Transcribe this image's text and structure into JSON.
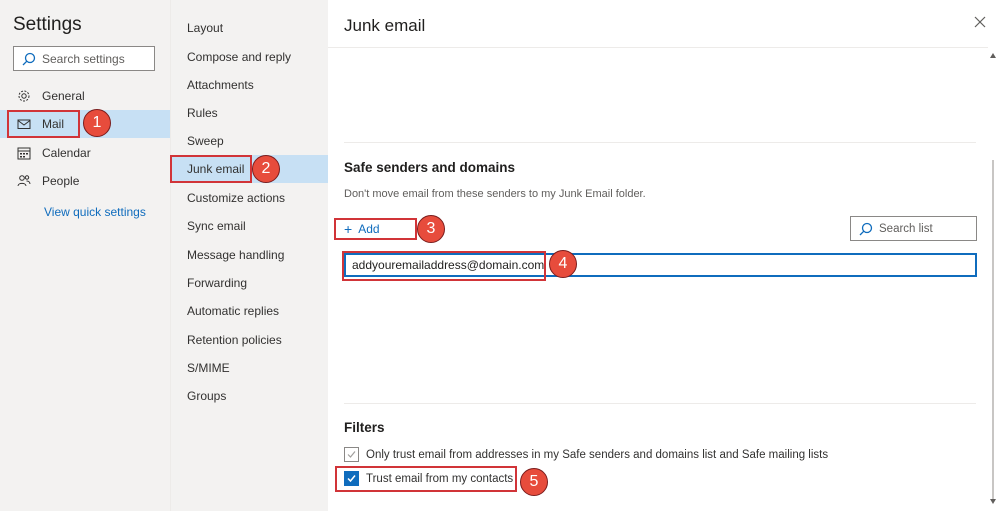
{
  "settings": {
    "title": "Settings",
    "search_placeholder": "Search settings",
    "nav": [
      {
        "label": "General",
        "icon": "gear-icon"
      },
      {
        "label": "Mail",
        "icon": "mail-icon"
      },
      {
        "label": "Calendar",
        "icon": "calendar-icon"
      },
      {
        "label": "People",
        "icon": "people-icon"
      }
    ],
    "quick_settings": "View quick settings"
  },
  "mail_menu": [
    "Layout",
    "Compose and reply",
    "Attachments",
    "Rules",
    "Sweep",
    "Junk email",
    "Customize actions",
    "Sync email",
    "Message handling",
    "Forwarding",
    "Automatic replies",
    "Retention policies",
    "S/MIME",
    "Groups"
  ],
  "panel": {
    "title": "Junk email",
    "safe_senders": {
      "title": "Safe senders and domains",
      "description": "Don't move email from these senders to my Junk Email folder.",
      "add_label": "Add",
      "search_list": "Search list",
      "email_value": "addyouremailaddress@domain.com"
    },
    "filters": {
      "title": "Filters",
      "option1": "Only trust email from addresses in my Safe senders and domains list and Safe mailing lists",
      "option2": "Trust email from my contacts"
    }
  },
  "annotations": [
    "1",
    "2",
    "3",
    "4",
    "5"
  ],
  "colors": {
    "accent": "#0f6cbd",
    "highlight": "#d13438",
    "badge": "#e74c3c",
    "selected": "#c7e0f4"
  }
}
